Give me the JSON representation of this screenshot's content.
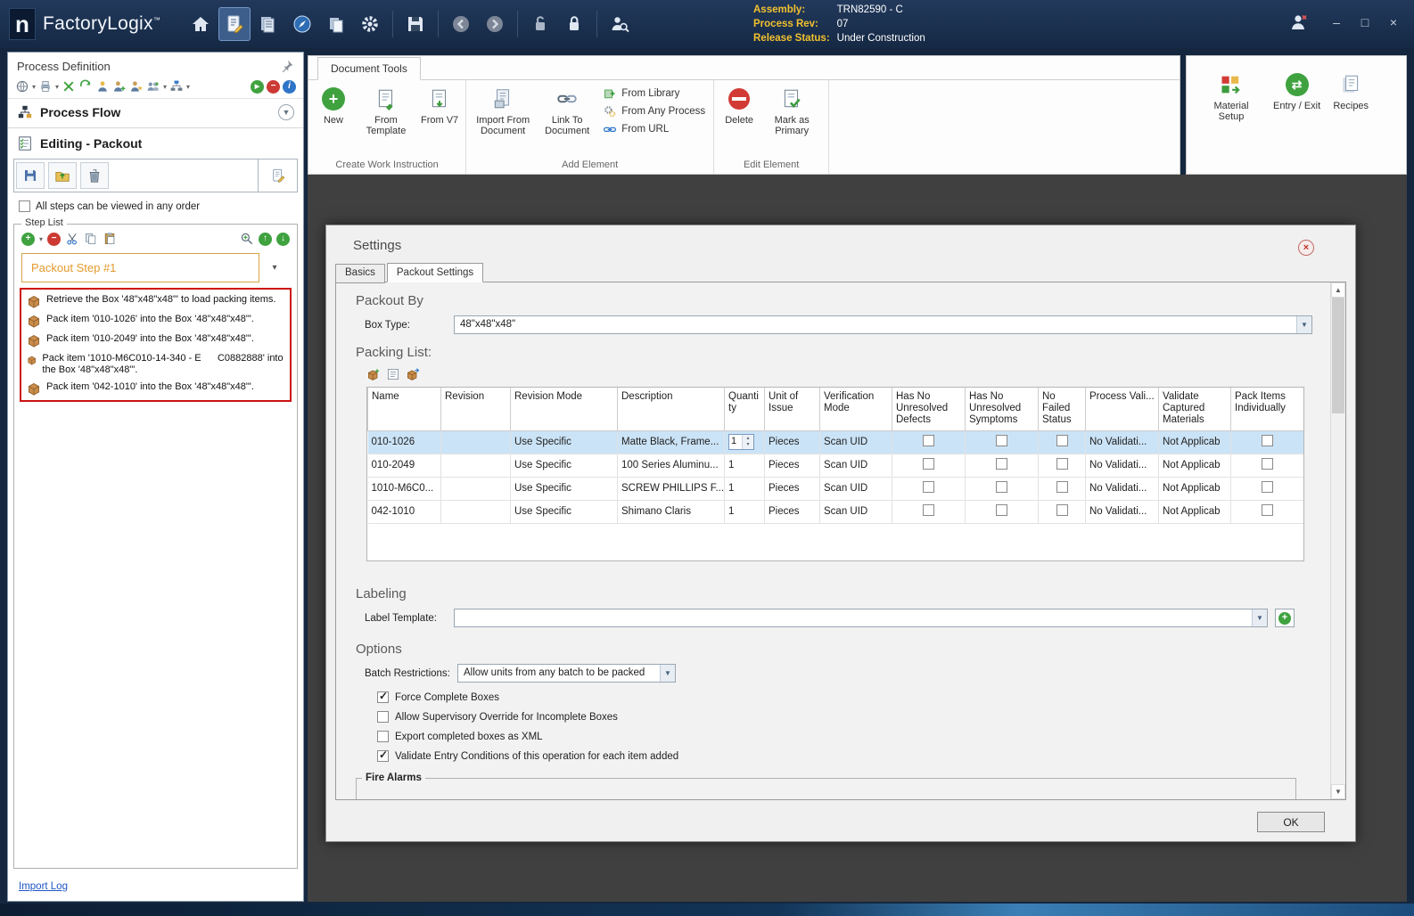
{
  "icons": {
    "caret_down": "▾",
    "plus": "+",
    "minus": "−",
    "close": "×",
    "check": "✓",
    "up_arrow": "↑",
    "down_arrow": "↓",
    "scroll_up": "▲",
    "scroll_down": "▼",
    "spin_up": "▴",
    "spin_down": "▾",
    "minimize": "–",
    "maximize": "□",
    "swap": "⇄",
    "run": "▶",
    "info": "i"
  },
  "titlebar": {
    "app_name": "FactoryLogix",
    "trademark": "™",
    "assembly_label": "Assembly:",
    "assembly_value": "TRN82590 - C",
    "process_rev_label": "Process Rev:",
    "process_rev_value": "07",
    "release_status_label": "Release Status:",
    "release_status_value": "Under Construction"
  },
  "left_panel": {
    "title": "Process Definition",
    "process_flow_label": "Process Flow",
    "editing_label": "Editing - Packout",
    "order_checkbox_label": "All steps can be viewed in any order",
    "order_checkbox_checked": false,
    "step_list_title": "Step List",
    "selected_step": "Packout Step #1",
    "steps": [
      "Retrieve the Box '48\"x48\"x48\"' to load packing items.",
      "Pack item '010-1026' into the Box '48\"x48\"x48\"'.",
      "Pack item '010-2049' into the Box '48\"x48\"x48\"'.",
      "Pack item '1010-M6C010-14-340 - E      C0882888' into the Box '48\"x48\"x48\"'.",
      "Pack item '042-1010' into the Box '48\"x48\"x48\"'."
    ],
    "import_log_label": "Import Log"
  },
  "ribbon": {
    "tab_label": "Document Tools",
    "create_group": {
      "label": "Create Work Instruction",
      "new_label": "New",
      "from_template_label": "From Template",
      "from_v7_label": "From V7"
    },
    "add_group": {
      "label": "Add Element",
      "import_from_document_label": "Import From Document",
      "link_to_document_label": "Link To Document",
      "from_library_label": "From Library",
      "from_any_process_label": "From Any Process",
      "from_url_label": "From URL"
    },
    "edit_group": {
      "label": "Edit Element",
      "delete_label": "Delete",
      "mark_as_primary_label": "Mark as Primary"
    },
    "right_group": {
      "material_setup_label": "Material Setup",
      "entry_exit_label": "Entry / Exit",
      "recipes_label": "Recipes"
    }
  },
  "settings": {
    "title": "Settings",
    "tab_basics": "Basics",
    "tab_packout": "Packout Settings",
    "packout_by_heading": "Packout By",
    "box_type_label": "Box Type:",
    "box_type_value": "48\"x48\"x48\"",
    "packing_list_heading": "Packing List:",
    "columns": [
      "Name",
      "Revision",
      "Revision Mode",
      "Description",
      "Quantity",
      "Unit of Issue",
      "Verification Mode",
      "Has No Unresolved Defects",
      "Has No Unresolved Symptoms",
      "No Failed Status",
      "Process Vali...",
      "Validate Captured Materials",
      "Pack Items Individually"
    ],
    "rows": [
      {
        "name": "010-1026",
        "revision": "",
        "revision_mode": "Use Specific",
        "description": "Matte Black, Frame...",
        "quantity": "1",
        "unit_of_issue": "Pieces",
        "verification_mode": "Scan UID",
        "has_no_unresolved_defects": false,
        "has_no_unresolved_symptoms": false,
        "no_failed_status": false,
        "process_validation": "No Validati...",
        "validate_captured": "Not Applicab",
        "pack_individually": false
      },
      {
        "name": "010-2049",
        "revision": "",
        "revision_mode": "Use Specific",
        "description": "100 Series Aluminu...",
        "quantity": "1",
        "unit_of_issue": "Pieces",
        "verification_mode": "Scan UID",
        "has_no_unresolved_defects": false,
        "has_no_unresolved_symptoms": false,
        "no_failed_status": false,
        "process_validation": "No Validati...",
        "validate_captured": "Not Applicab",
        "pack_individually": false
      },
      {
        "name": "1010-M6C0...",
        "revision": "",
        "revision_mode": "Use Specific",
        "description": "SCREW PHILLIPS F...",
        "quantity": "1",
        "unit_of_issue": "Pieces",
        "verification_mode": "Scan UID",
        "has_no_unresolved_defects": false,
        "has_no_unresolved_symptoms": false,
        "no_failed_status": false,
        "process_validation": "No Validati...",
        "validate_captured": "Not Applicab",
        "pack_individually": false
      },
      {
        "name": "042-1010",
        "revision": "",
        "revision_mode": "Use Specific",
        "description": "Shimano Claris",
        "quantity": "1",
        "unit_of_issue": "Pieces",
        "verification_mode": "Scan UID",
        "has_no_unresolved_defects": false,
        "has_no_unresolved_symptoms": false,
        "no_failed_status": false,
        "process_validation": "No Validati...",
        "validate_captured": "Not Applicab",
        "pack_individually": false
      }
    ],
    "labeling_heading": "Labeling",
    "label_template_label": "Label Template:",
    "label_template_value": "",
    "options_heading": "Options",
    "batch_restrictions_label": "Batch Restrictions:",
    "batch_restrictions_value": "Allow units from any batch to be packed",
    "options_checks": [
      {
        "label": "Force Complete Boxes",
        "checked": true
      },
      {
        "label": "Allow Supervisory Override for Incomplete Boxes",
        "checked": false
      },
      {
        "label": "Export completed boxes as XML",
        "checked": false
      },
      {
        "label": "Validate Entry Conditions of this operation for each item added",
        "checked": true
      }
    ],
    "fire_alarms_heading": "Fire Alarms",
    "ok_label": "OK"
  }
}
